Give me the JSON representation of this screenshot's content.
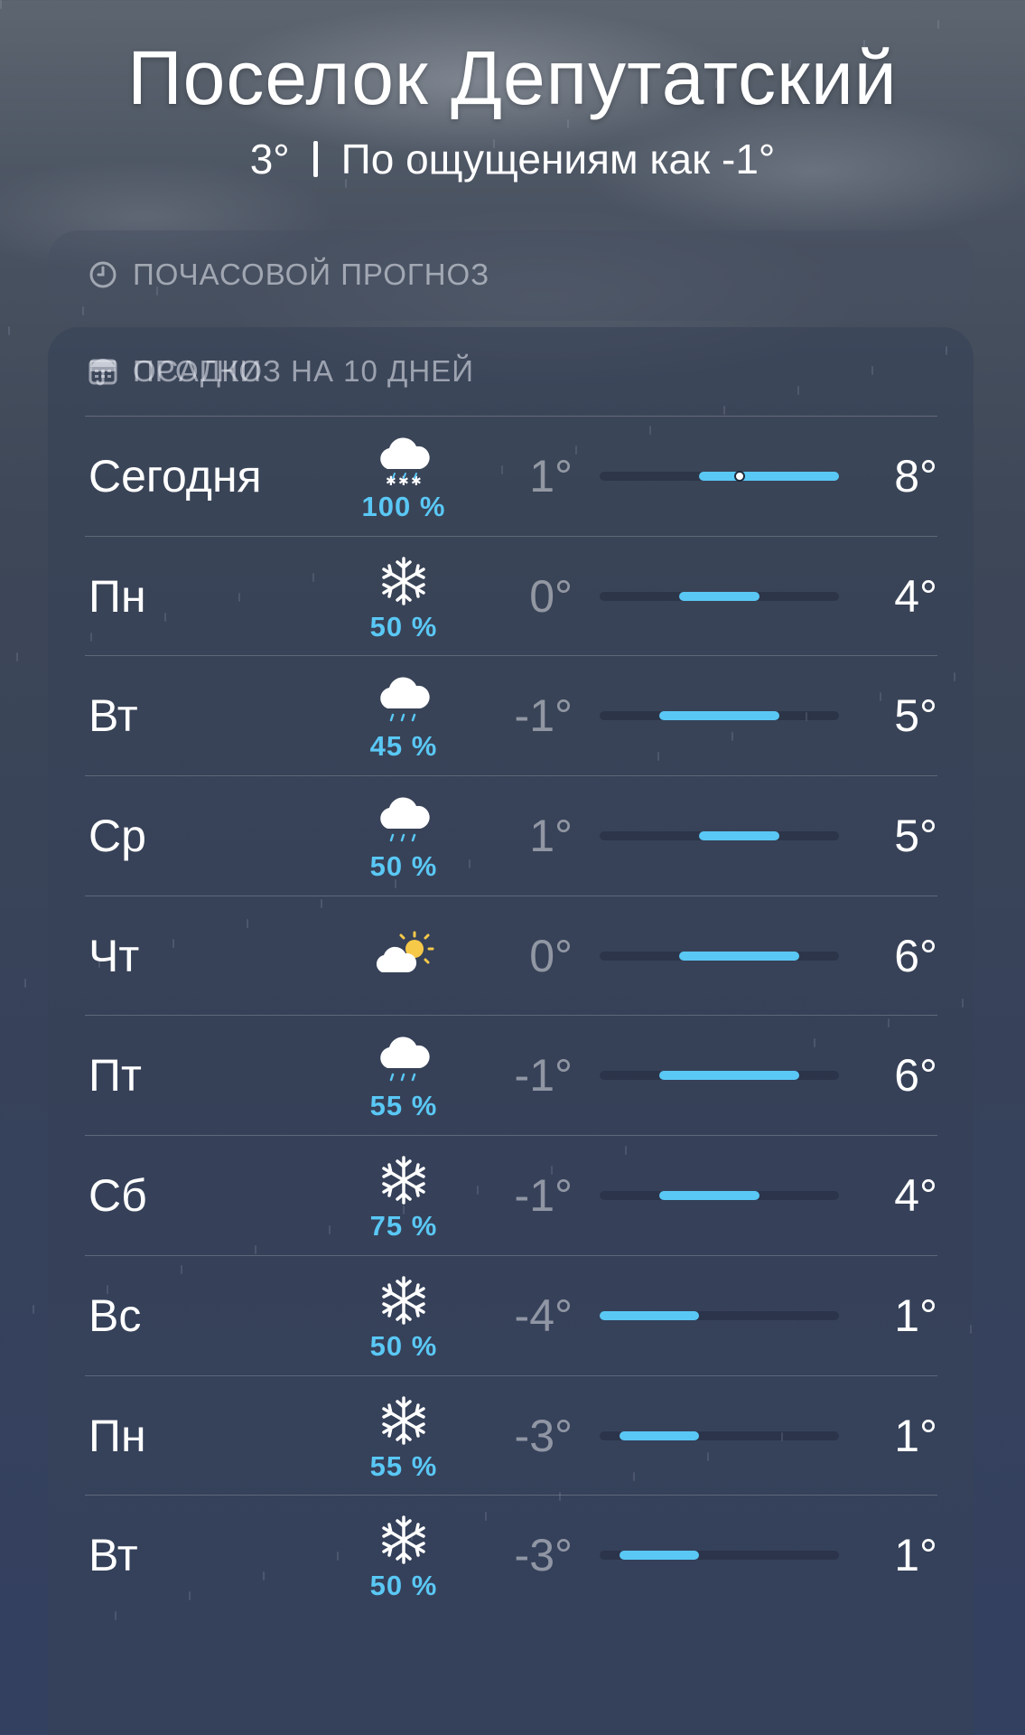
{
  "header": {
    "city": "Поселок Депутатский",
    "current_temp": "3°",
    "feels_like": "По ощущениям как -1°"
  },
  "hourly_card": {
    "label": "ПОЧАСОВОЙ ПРОГНОЗ",
    "icon": "clock-icon"
  },
  "daily_card": {
    "label": "ПРОГНОЗ НА 10 ДНЕЙ",
    "icon": "calendar-icon",
    "range_min": -4,
    "range_max": 8,
    "current_temp_value": 3,
    "bar_color": "#5ac8f5",
    "days": [
      {
        "day": "Сегодня",
        "icon": "cloud-snow-icon",
        "prob": "100 %",
        "low": "1°",
        "high": "8°",
        "low_v": 1,
        "high_v": 8,
        "current": true
      },
      {
        "day": "Пн",
        "icon": "snowflake-icon",
        "prob": "50 %",
        "low": "0°",
        "high": "4°",
        "low_v": 0,
        "high_v": 4
      },
      {
        "day": "Вт",
        "icon": "cloud-drizzle-icon",
        "prob": "45 %",
        "low": "-1°",
        "high": "5°",
        "low_v": -1,
        "high_v": 5
      },
      {
        "day": "Ср",
        "icon": "cloud-drizzle-icon",
        "prob": "50 %",
        "low": "1°",
        "high": "5°",
        "low_v": 1,
        "high_v": 5
      },
      {
        "day": "Чт",
        "icon": "cloud-sun-icon",
        "prob": "",
        "low": "0°",
        "high": "6°",
        "low_v": 0,
        "high_v": 6
      },
      {
        "day": "Пт",
        "icon": "cloud-drizzle-icon",
        "prob": "55 %",
        "low": "-1°",
        "high": "6°",
        "low_v": -1,
        "high_v": 6
      },
      {
        "day": "Сб",
        "icon": "snowflake-icon",
        "prob": "75 %",
        "low": "-1°",
        "high": "4°",
        "low_v": -1,
        "high_v": 4
      },
      {
        "day": "Вс",
        "icon": "snowflake-icon",
        "prob": "50 %",
        "low": "-4°",
        "high": "1°",
        "low_v": -4,
        "high_v": 1
      },
      {
        "day": "Пн",
        "icon": "snowflake-icon",
        "prob": "55 %",
        "low": "-3°",
        "high": "1°",
        "low_v": -3,
        "high_v": 1
      },
      {
        "day": "Вт",
        "icon": "snowflake-icon",
        "prob": "50 %",
        "low": "-3°",
        "high": "1°",
        "low_v": -3,
        "high_v": 1
      }
    ]
  },
  "precip_card": {
    "label": "ОСАДКИ",
    "icon": "umbrella-icon"
  }
}
